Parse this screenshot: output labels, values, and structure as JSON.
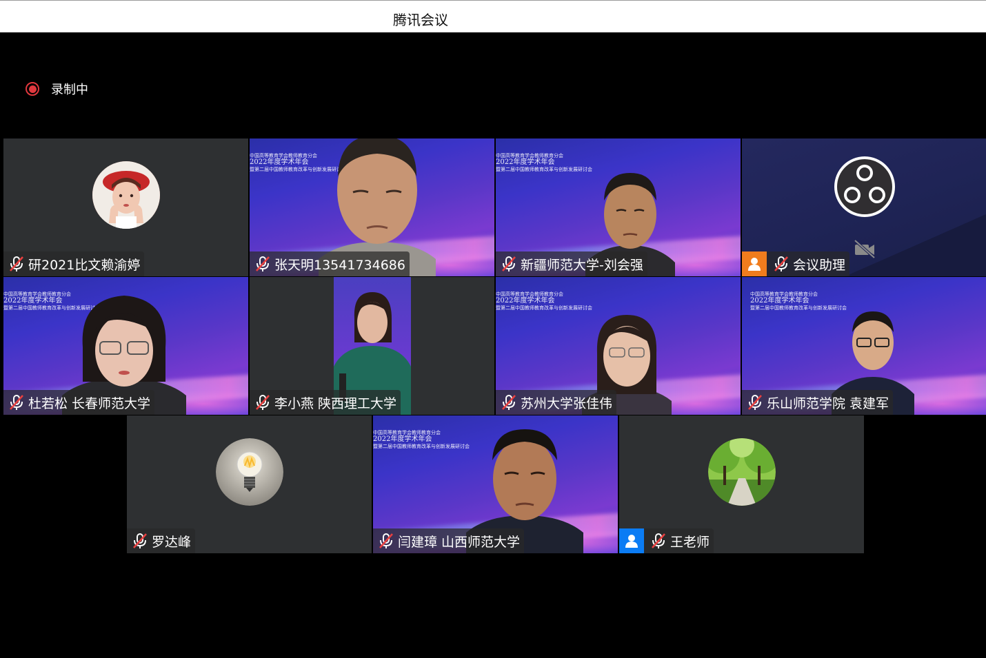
{
  "window": {
    "title": "腾讯会议"
  },
  "recording": {
    "label": "录制中",
    "color": "#e0383e"
  },
  "icons": {
    "mic": "mic-muted-icon",
    "camera_off": "camera-off-icon",
    "host_badge": "person-icon"
  },
  "banner": {
    "line1": "中国高等教育学会教师教育分会",
    "line2": "2022年度学术年会",
    "line3": "暨第二届中国教师教育改革与创新发展研讨会"
  },
  "participants": [
    {
      "name": "研2021比文赖渝婷",
      "video": false
    },
    {
      "name": "张天明13541734686",
      "video": true
    },
    {
      "name": "新疆师范大学-刘会强",
      "video": true
    },
    {
      "name": "会议助理",
      "video": false
    },
    {
      "name": "杜若松 长春师范大学",
      "video": true
    },
    {
      "name": "李小燕  陕西理工大学",
      "video": true
    },
    {
      "name": "苏州大学张佳伟",
      "video": true
    },
    {
      "name": "乐山师范学院 袁建军",
      "video": true
    },
    {
      "name": "罗达峰",
      "video": false
    },
    {
      "name": "闫建璋 山西师范大学",
      "video": true
    },
    {
      "name": "王老师",
      "video": false
    }
  ]
}
